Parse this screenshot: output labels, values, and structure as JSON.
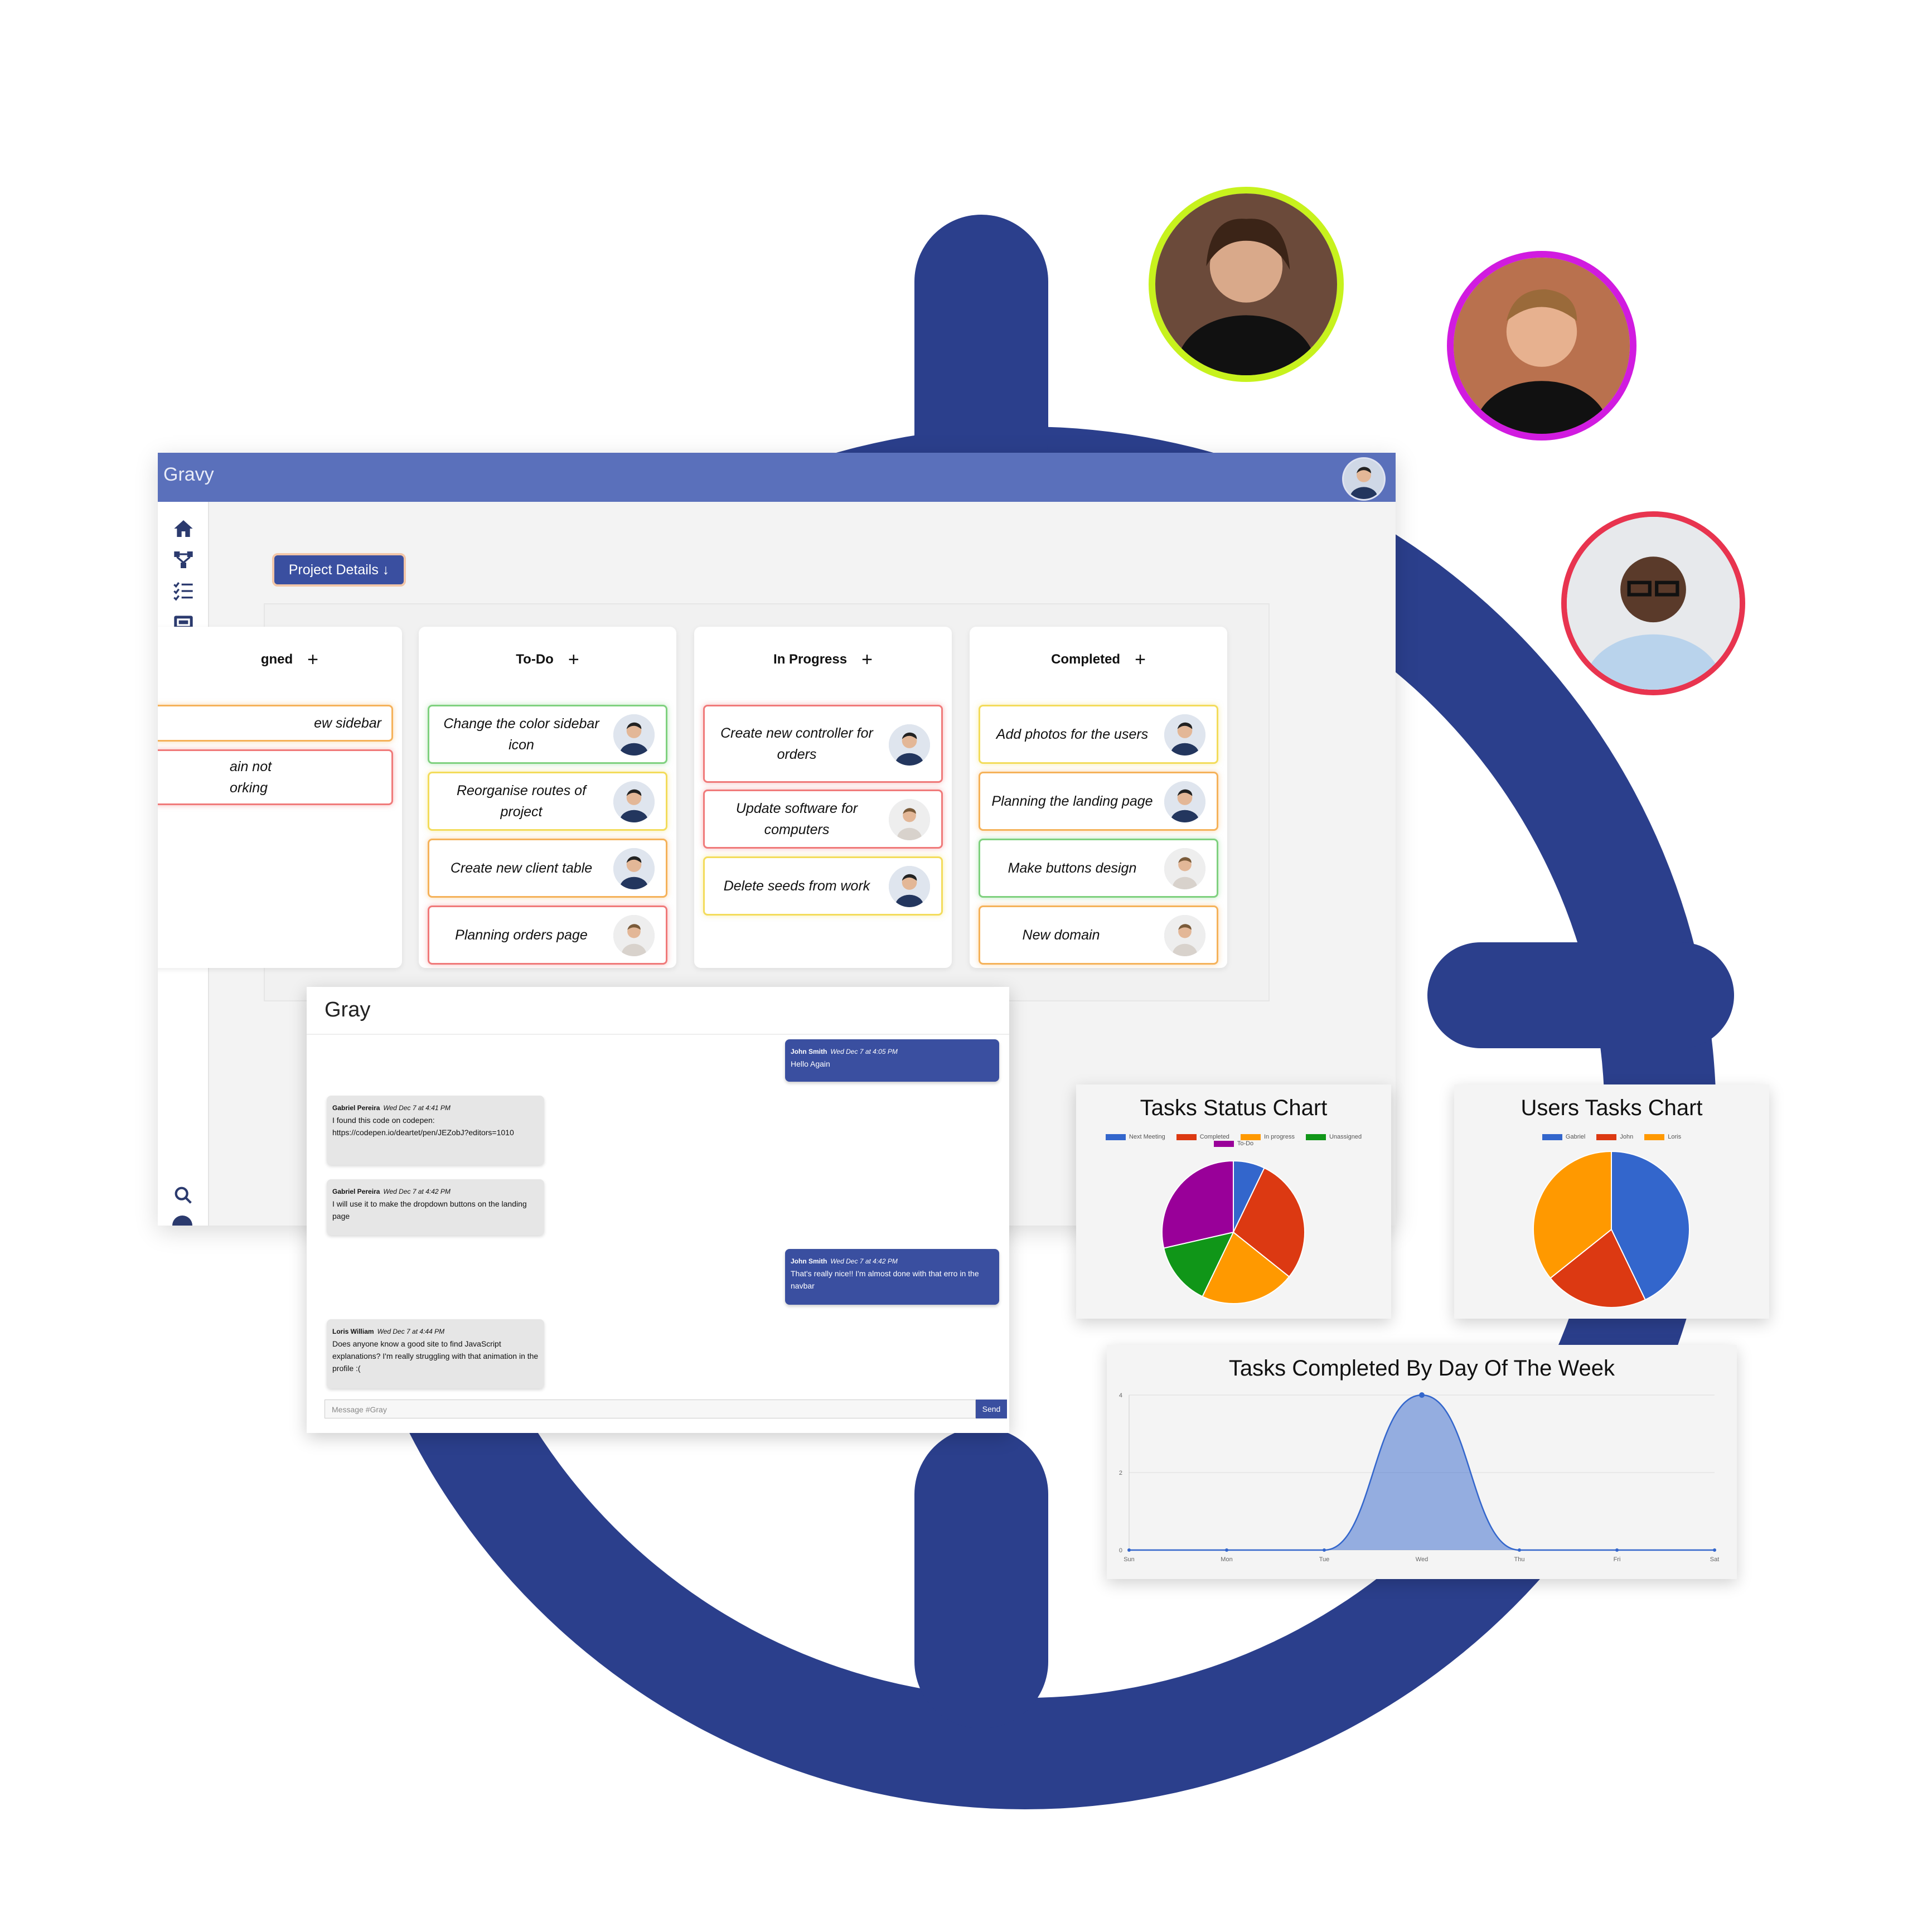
{
  "brand_color": "#2b3f8c",
  "app": {
    "title": "Gravy",
    "project_button": "Project Details ↓",
    "sidebar_icons": [
      "home-icon",
      "network-icon",
      "checklist-icon",
      "ticket-icon",
      "line-chart-icon",
      "search-icon"
    ]
  },
  "board": {
    "columns": [
      {
        "title": "Unassigned",
        "visible_title": "gned",
        "cards": [
          {
            "text": "ew sidebar",
            "border": "orange"
          },
          {
            "text": "ain not orking",
            "border": "red"
          }
        ]
      },
      {
        "title": "To-Do",
        "cards": [
          {
            "text": "Change the color sidebar icon",
            "border": "green"
          },
          {
            "text": "Reorganise routes of project",
            "border": "yellow"
          },
          {
            "text": "Create new client table",
            "border": "orange"
          },
          {
            "text": "Planning orders page",
            "border": "red"
          }
        ]
      },
      {
        "title": "In Progress",
        "cards": [
          {
            "text": "Create new controller for orders",
            "border": "red"
          },
          {
            "text": "Update software for computers",
            "border": "red"
          },
          {
            "text": "Delete seeds from work",
            "border": "yellow"
          }
        ]
      },
      {
        "title": "Completed",
        "cards": [
          {
            "text": "Add photos for the users",
            "border": "yellow"
          },
          {
            "text": "Planning the landing page",
            "border": "orange"
          },
          {
            "text": "Make buttons design",
            "border": "green"
          },
          {
            "text": "New domain",
            "border": "orange"
          }
        ]
      }
    ]
  },
  "chat": {
    "channel": "Gray",
    "messages": [
      {
        "author": "John Smith",
        "time": "Wed Dec 7 at 4:05 PM",
        "text": "Hello Again",
        "side": "out"
      },
      {
        "author": "Gabriel Pereira",
        "time": "Wed Dec 7 at 4:41 PM",
        "text": "I found this code on codepen: https://codepen.io/deartet/pen/JEZobJ?editors=1010",
        "side": "in"
      },
      {
        "author": "Gabriel Pereira",
        "time": "Wed Dec 7 at 4:42 PM",
        "text": "I will use it to make the dropdown buttons on the landing page",
        "side": "in"
      },
      {
        "author": "John Smith",
        "time": "Wed Dec 7 at 4:42 PM",
        "text": "That's really nice!! I'm almost done with that erro in the navbar",
        "side": "out"
      },
      {
        "author": "Loris William",
        "time": "Wed Dec 7 at 4:44 PM",
        "text": "Does anyone know a good site to find JavaScript explanations? I'm really struggling with that animation in the profile :(",
        "side": "in"
      }
    ],
    "input_placeholder": "Message #Gray",
    "send_label": "Send"
  },
  "chart_data": [
    {
      "type": "pie",
      "title": "Tasks Status Chart",
      "labels": [
        "Next Meeting",
        "Completed",
        "In progress",
        "Unassigned",
        "To-Do"
      ],
      "values": [
        1,
        4,
        3,
        2,
        4
      ],
      "colors": [
        "#3366cc",
        "#dc3912",
        "#ff9900",
        "#109618",
        "#990099"
      ]
    },
    {
      "type": "pie",
      "title": "Users Tasks Chart",
      "labels": [
        "Gabriel",
        "John",
        "Loris"
      ],
      "values": [
        6,
        3,
        5
      ],
      "colors": [
        "#3366cc",
        "#dc3912",
        "#ff9900"
      ]
    },
    {
      "type": "area",
      "title": "Tasks Completed By Day Of The Week",
      "categories": [
        "Sun",
        "Mon",
        "Tue",
        "Wed",
        "Thu",
        "Fri",
        "Sat"
      ],
      "values": [
        0,
        0,
        0,
        4,
        0,
        0,
        0
      ],
      "yticks": [
        0,
        2,
        4
      ],
      "ylim": [
        0,
        4
      ],
      "color": "#3366cc"
    }
  ]
}
